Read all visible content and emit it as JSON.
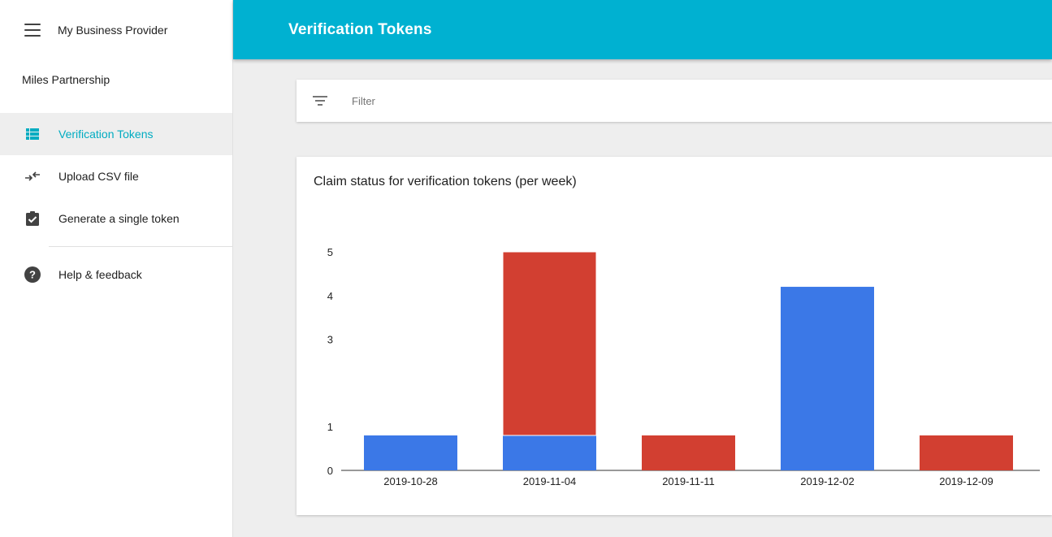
{
  "sidebar": {
    "app_title": "My Business Provider",
    "account": "Miles Partnership",
    "items": [
      {
        "label": "Verification Tokens",
        "icon": "list-icon",
        "active": true
      },
      {
        "label": "Upload CSV file",
        "icon": "swap-arrows-icon",
        "active": false
      },
      {
        "label": "Generate a single token",
        "icon": "clipboard-check-icon",
        "active": false
      },
      {
        "label": "Help & feedback",
        "icon": "help-icon",
        "active": false
      }
    ]
  },
  "header": {
    "title": "Verification Tokens"
  },
  "filter": {
    "label": "Filter"
  },
  "colors": {
    "accent": "#00b1d1",
    "active_nav": "#00acc1",
    "series_blue": "#3b78e7",
    "series_red": "#d23f31"
  },
  "chart_data": {
    "type": "bar",
    "stacked": true,
    "title": "Claim status for verification tokens (per week)",
    "categories": [
      "2019-10-28",
      "2019-11-04",
      "2019-11-11",
      "2019-12-02",
      "2019-12-09"
    ],
    "series": [
      {
        "color": "#3b78e7",
        "values": [
          0.8,
          0.8,
          0,
          4.2,
          0
        ]
      },
      {
        "color": "#d23f31",
        "values": [
          0,
          4.2,
          0.8,
          0,
          0.8
        ]
      }
    ],
    "y_ticks": [
      0,
      1,
      3,
      4,
      5
    ],
    "ylim": [
      0,
      5
    ],
    "grid": false,
    "legend": "none"
  }
}
